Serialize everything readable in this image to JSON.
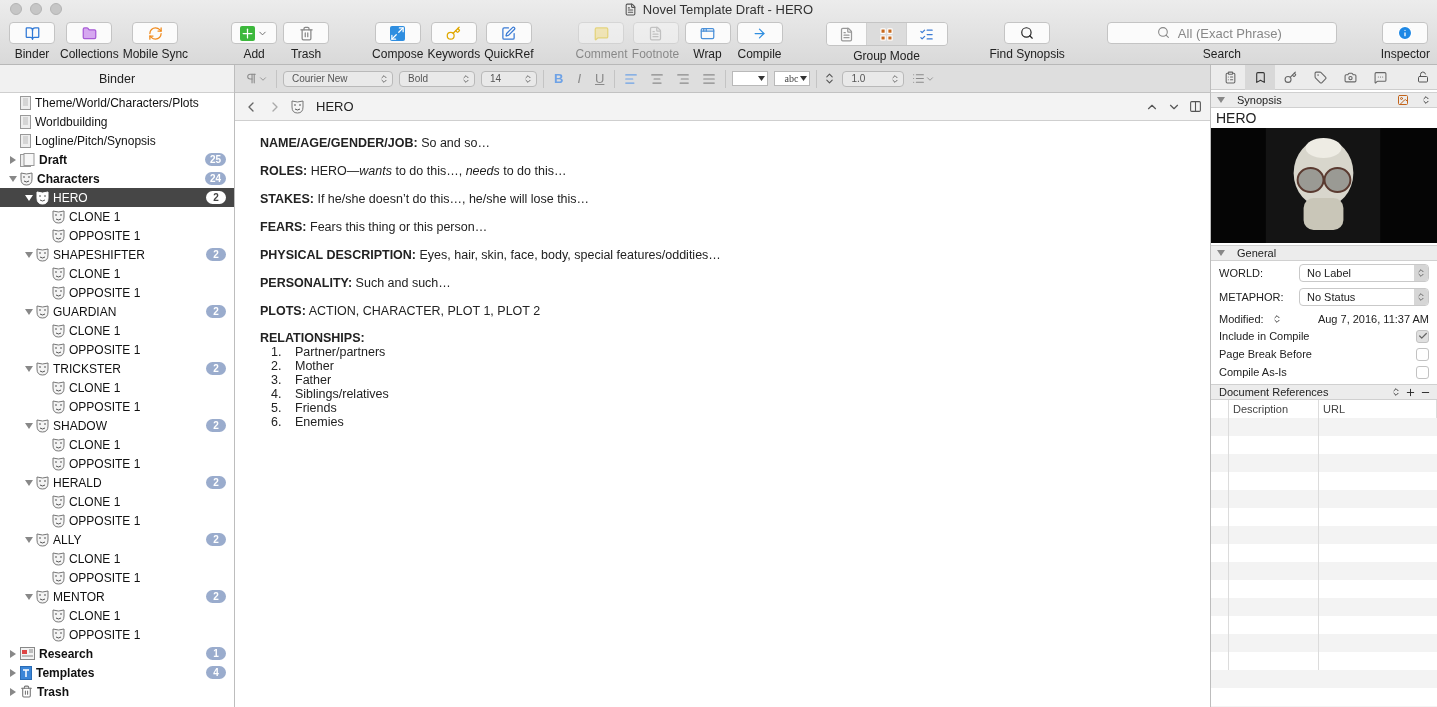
{
  "window": {
    "title": "Novel Template Draft - HERO"
  },
  "toolbar": {
    "groups": [
      [
        {
          "label": "Binder",
          "kind": "binder",
          "disabled": false
        },
        {
          "label": "Collections",
          "kind": "collections",
          "disabled": false
        },
        {
          "label": "Mobile Sync",
          "kind": "sync",
          "disabled": false
        }
      ],
      [
        {
          "label": "Add",
          "kind": "add",
          "disabled": false,
          "menu": true
        },
        {
          "label": "Trash",
          "kind": "trash",
          "disabled": false
        }
      ],
      [
        {
          "label": "Compose",
          "kind": "compose",
          "disabled": false
        },
        {
          "label": "Keywords",
          "kind": "keywords",
          "disabled": false
        },
        {
          "label": "QuickRef",
          "kind": "quickref",
          "disabled": false
        }
      ],
      [
        {
          "label": "Comment",
          "kind": "comment",
          "disabled": true
        },
        {
          "label": "Footnote",
          "kind": "footnote",
          "disabled": true
        },
        {
          "label": "Wrap",
          "kind": "wrap",
          "disabled": false
        },
        {
          "label": "Compile",
          "kind": "compile",
          "disabled": false
        }
      ]
    ],
    "group_mode": {
      "label": "Group Mode",
      "segments": [
        {
          "kind": "document",
          "selected": false
        },
        {
          "kind": "corkboard",
          "selected": true
        },
        {
          "kind": "outline",
          "selected": false
        }
      ]
    },
    "find_synopsis": {
      "label": "Find Synopsis"
    },
    "search": {
      "placeholder": "All (Exact Phrase)",
      "label": "Search"
    },
    "inspector_button": {
      "label": "Inspector"
    }
  },
  "binder": {
    "header": "Binder",
    "items": [
      {
        "label": "Theme/World/Characters/Plots",
        "kind": "document",
        "bold": false,
        "selected": false
      },
      {
        "label": "Worldbuilding",
        "kind": "document",
        "bold": false,
        "selected": false
      },
      {
        "label": "Logline/Pitch/Synopsis",
        "kind": "document",
        "bold": false,
        "selected": false
      },
      {
        "label": "Draft",
        "kind": "draft",
        "bold": true,
        "selected": false,
        "expanded": false,
        "count": "25"
      },
      {
        "label": "Characters",
        "kind": "character",
        "bold": true,
        "selected": false,
        "expanded": true,
        "count": "24",
        "children": [
          {
            "label": "HERO",
            "kind": "character",
            "bold": false,
            "selected": true,
            "expanded": true,
            "count": "2",
            "children": [
              {
                "label": "CLONE 1",
                "kind": "character",
                "bold": false,
                "selected": false
              },
              {
                "label": "OPPOSITE 1",
                "kind": "character",
                "bold": false,
                "selected": false
              }
            ]
          },
          {
            "label": "SHAPESHIFTER",
            "kind": "character",
            "bold": false,
            "selected": false,
            "expanded": true,
            "count": "2",
            "children": [
              {
                "label": "CLONE 1",
                "kind": "character",
                "bold": false,
                "selected": false
              },
              {
                "label": "OPPOSITE 1",
                "kind": "character",
                "bold": false,
                "selected": false
              }
            ]
          },
          {
            "label": "GUARDIAN",
            "kind": "character",
            "bold": false,
            "selected": false,
            "expanded": true,
            "count": "2",
            "children": [
              {
                "label": "CLONE 1",
                "kind": "character",
                "bold": false,
                "selected": false
              },
              {
                "label": "OPPOSITE 1",
                "kind": "character",
                "bold": false,
                "selected": false
              }
            ]
          },
          {
            "label": "TRICKSTER",
            "kind": "character",
            "bold": false,
            "selected": false,
            "expanded": true,
            "count": "2",
            "children": [
              {
                "label": "CLONE 1",
                "kind": "character",
                "bold": false,
                "selected": false
              },
              {
                "label": "OPPOSITE 1",
                "kind": "character",
                "bold": false,
                "selected": false
              }
            ]
          },
          {
            "label": "SHADOW",
            "kind": "character",
            "bold": false,
            "selected": false,
            "expanded": true,
            "count": "2",
            "children": [
              {
                "label": "CLONE 1",
                "kind": "character",
                "bold": false,
                "selected": false
              },
              {
                "label": "OPPOSITE 1",
                "kind": "character",
                "bold": false,
                "selected": false
              }
            ]
          },
          {
            "label": "HERALD",
            "kind": "character",
            "bold": false,
            "selected": false,
            "expanded": true,
            "count": "2",
            "children": [
              {
                "label": "CLONE 1",
                "kind": "character",
                "bold": false,
                "selected": false
              },
              {
                "label": "OPPOSITE 1",
                "kind": "character",
                "bold": false,
                "selected": false
              }
            ]
          },
          {
            "label": "ALLY",
            "kind": "character",
            "bold": false,
            "selected": false,
            "expanded": true,
            "count": "2",
            "children": [
              {
                "label": "CLONE 1",
                "kind": "character",
                "bold": false,
                "selected": false
              },
              {
                "label": "OPPOSITE 1",
                "kind": "character",
                "bold": false,
                "selected": false
              }
            ]
          },
          {
            "label": "MENTOR",
            "kind": "character",
            "bold": false,
            "selected": false,
            "expanded": true,
            "count": "2",
            "children": [
              {
                "label": "CLONE 1",
                "kind": "character",
                "bold": false,
                "selected": false
              },
              {
                "label": "OPPOSITE 1",
                "kind": "character",
                "bold": false,
                "selected": false
              }
            ]
          }
        ]
      },
      {
        "label": "Research",
        "kind": "research",
        "bold": true,
        "selected": false,
        "expanded": false,
        "count": "1"
      },
      {
        "label": "Templates",
        "kind": "templates",
        "bold": true,
        "selected": false,
        "expanded": false,
        "count": "4"
      },
      {
        "label": "Trash",
        "kind": "trash",
        "bold": true,
        "selected": false,
        "expanded": false
      }
    ]
  },
  "format_bar": {
    "font": "Courier New",
    "weight": "Bold",
    "size": "14",
    "styles": [
      {
        "label": "B",
        "kind": "bold",
        "active": true
      },
      {
        "label": "I",
        "kind": "italic",
        "active": false
      },
      {
        "label": "U",
        "kind": "underline",
        "active": false
      }
    ],
    "alignments": [
      {
        "kind": "left",
        "selected": true
      },
      {
        "kind": "center",
        "selected": false
      },
      {
        "kind": "right",
        "selected": false
      },
      {
        "kind": "justify",
        "selected": false
      }
    ],
    "highlight_sample": "abc",
    "line_spacing": "1.0"
  },
  "editor": {
    "title": "HERO",
    "paragraphs": [
      "**NAME/AGE/GENDER/JOB:** So and so…",
      "**ROLES:** HERO—*wants* to do this…, *needs* to do this…",
      "**STAKES:** If he/she doesn’t do this…, he/she will lose this…",
      "**FEARS:** Fears this thing or this person…",
      "**PHYSICAL DESCRIPTION:** Eyes, hair, skin, face, body, special features/oddities…",
      "**PERSONALITY:** Such and such…",
      "**PLOTS:** ACTION, CHARACTER, PLOT 1, PLOT 2"
    ],
    "list_heading": "RELATIONSHIPS:",
    "list": [
      {
        "number": "1.",
        "text": "Partner/partners"
      },
      {
        "number": "2.",
        "text": "Mother"
      },
      {
        "number": "3.",
        "text": "Father"
      },
      {
        "number": "4.",
        "text": "Siblings/relatives"
      },
      {
        "number": "5.",
        "text": "Friends"
      },
      {
        "number": "6.",
        "text": "Enemies"
      }
    ]
  },
  "inspector": {
    "tabs": [
      {
        "kind": "notes",
        "selected": false
      },
      {
        "kind": "bookmark",
        "selected": true
      },
      {
        "kind": "key",
        "selected": false
      },
      {
        "kind": "tag",
        "selected": false
      },
      {
        "kind": "camera",
        "selected": false
      },
      {
        "kind": "comment",
        "selected": false
      }
    ],
    "synopsis": {
      "header": "Synopsis",
      "title": "HERO"
    },
    "general": {
      "header": "General",
      "fields": [
        {
          "label": "WORLD:",
          "value": "No Label"
        },
        {
          "label": "METAPHOR:",
          "value": "No Status"
        }
      ],
      "modified_label": "Modified:",
      "modified": "Aug 7, 2016, 11:37 AM",
      "options": [
        {
          "label": "Include in Compile",
          "checked": true
        },
        {
          "label": "Page Break Before",
          "checked": false
        },
        {
          "label": "Compile As-Is",
          "checked": false
        }
      ]
    },
    "references": {
      "header": "Document References",
      "columns": [
        "Description",
        "URL"
      ]
    }
  }
}
